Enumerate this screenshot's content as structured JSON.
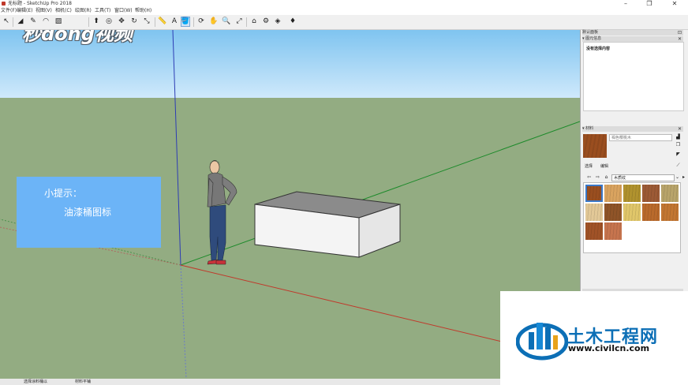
{
  "app": {
    "window_title": "无标题 - SketchUp Pro 2018",
    "window_controls": {
      "minimize": "–",
      "maximize": "❐",
      "close": "✕"
    }
  },
  "menu": [
    "文件(F)",
    "编辑(E)",
    "视图(V)",
    "相机(C)",
    "绘图(R)",
    "工具(T)",
    "窗口(W)",
    "帮助(H)"
  ],
  "toolbar": {
    "tools": [
      {
        "name": "select-tool",
        "glyph": "↖"
      },
      {
        "name": "eraser-tool",
        "glyph": "◢"
      },
      {
        "name": "pencil-tool",
        "glyph": "✎"
      },
      {
        "name": "arc-tool",
        "glyph": "◠"
      },
      {
        "name": "rectangle-tool",
        "glyph": "▨"
      },
      {
        "name": "push-pull-tool",
        "glyph": "⬆"
      },
      {
        "name": "offset-tool",
        "glyph": "◎"
      },
      {
        "name": "move-tool",
        "glyph": "✥"
      },
      {
        "name": "rotate-tool",
        "glyph": "↻"
      },
      {
        "name": "scale-tool",
        "glyph": "⤡"
      },
      {
        "name": "tape-measure-tool",
        "glyph": "📏"
      },
      {
        "name": "text-tool",
        "glyph": "A"
      },
      {
        "name": "paint-bucket-tool",
        "glyph": "🪣"
      },
      {
        "name": "orbit-tool",
        "glyph": "⟳"
      },
      {
        "name": "pan-tool",
        "glyph": "✋"
      },
      {
        "name": "zoom-tool",
        "glyph": "🔍"
      },
      {
        "name": "zoom-extents-tool",
        "glyph": "⤢"
      },
      {
        "name": "warehouse-tool",
        "glyph": "⌂"
      },
      {
        "name": "extension-tool",
        "glyph": "⚙"
      },
      {
        "name": "layout-tool",
        "glyph": "◈"
      },
      {
        "name": "ruby-tool",
        "glyph": "♦"
      }
    ]
  },
  "viewport": {
    "brand_logo": "秒dong视频",
    "tip": {
      "heading": "小提示：",
      "body": "油漆桶图标"
    }
  },
  "tray": {
    "title": "默认面板",
    "entity_info": {
      "header": "图元信息",
      "empty_text": "没有选择内容"
    },
    "materials": {
      "header": "材料",
      "current_name": "褐色樱桃木",
      "tabs": [
        "选择",
        "编辑"
      ],
      "library": "木质纹",
      "swatches": [
        "#9a4e1f",
        "#d9a35f",
        "#b0922e",
        "#9c5a35",
        "#b8a46a",
        "#e2c897",
        "#8f5428",
        "#e0c66a",
        "#b96a2c",
        "#c27632",
        "#a05227",
        "#c6744e"
      ]
    }
  },
  "status": {
    "text": "选择涂料桶以",
    "hint": "材料平铺"
  },
  "watermark": {
    "name": "土木工程网",
    "url": "www.civilcn.com"
  },
  "colors": {
    "sky_top": "#7fc4f0",
    "ground": "#93ac82",
    "tip_bg": "#6cb4f7",
    "accent": "#0c6fb6"
  }
}
